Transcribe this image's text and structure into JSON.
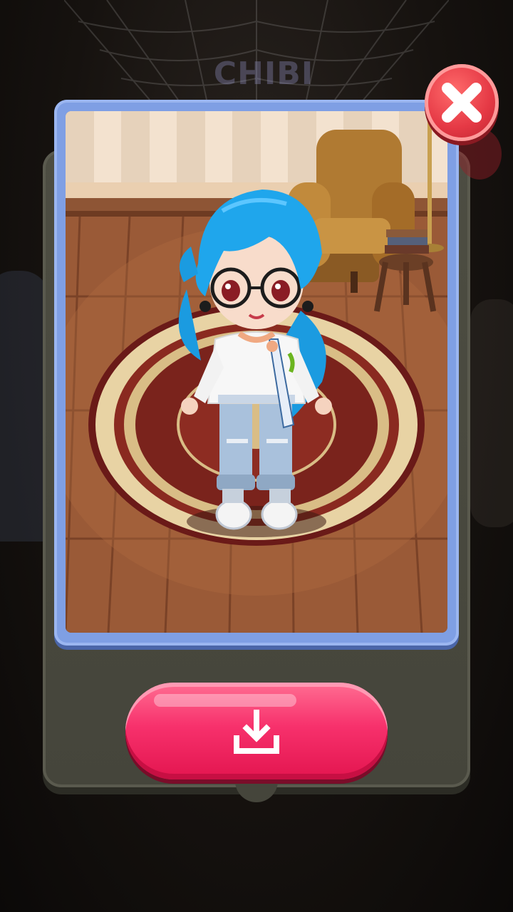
{
  "background": {
    "logo_text": "CHIBI"
  },
  "dialog": {
    "close_icon": "close-x-icon",
    "download_icon": "download-icon",
    "colors": {
      "panel": "#4d4d42",
      "frame": "#7f9fe4",
      "close_button": "#e53945",
      "download_button": "#f7316c"
    }
  }
}
